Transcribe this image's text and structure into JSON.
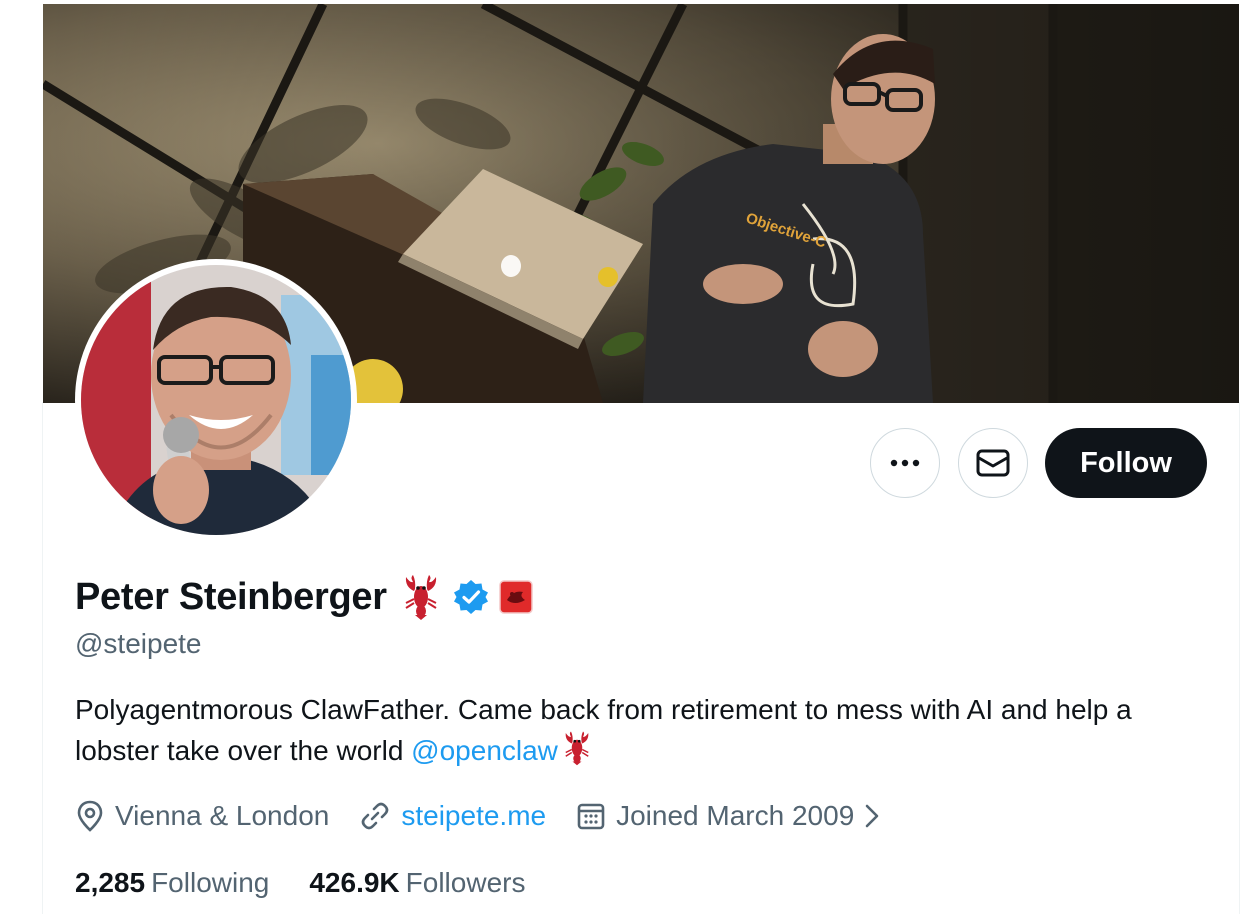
{
  "profile": {
    "display_name": "Peter Steinberger",
    "handle": "@steipete",
    "bio_text": "Polyagentmorous ClawFather. Came back from retirement to mess with AI and help a lobster take over the world ",
    "bio_mention": "@openclaw",
    "location": "Vienna & London",
    "website": "steipete.me",
    "joined": "Joined March 2009",
    "banner_shirt_text": "Objective-C"
  },
  "actions": {
    "follow_label": "Follow"
  },
  "stats": {
    "following_count": "2,285",
    "following_label": "Following",
    "followers_count": "426.9K",
    "followers_label": "Followers"
  },
  "colors": {
    "accent": "#1d9bf0",
    "text_primary": "#0f1419",
    "text_secondary": "#536471",
    "follow_bg": "#0f1419",
    "border": "#cfd9de",
    "lobster": "#c8202f"
  },
  "icons": [
    "more-icon",
    "mail-icon",
    "lobster-emoji-icon",
    "verified-badge-icon",
    "affiliate-badge-icon",
    "location-icon",
    "link-icon",
    "calendar-icon",
    "chevron-right-icon"
  ]
}
